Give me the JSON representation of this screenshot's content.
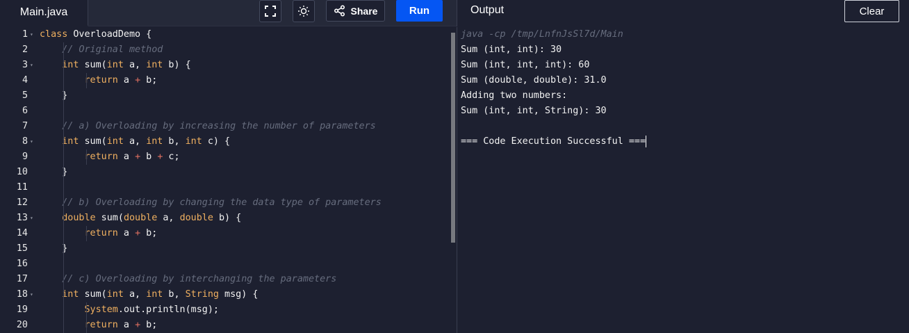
{
  "tab": {
    "label": "Main.java"
  },
  "toolbar": {
    "share_label": "Share",
    "run_label": "Run",
    "fullscreen_icon": "fullscreen-icon",
    "theme_icon": "sun-icon"
  },
  "output": {
    "title": "Output",
    "clear_label": "Clear",
    "command": "java -cp /tmp/LnfnJsSl7d/Main",
    "lines": [
      "Sum (int, int): 30",
      "Sum (int, int, int): 60",
      "Sum (double, double): 31.0",
      "Adding two numbers:",
      "Sum (int, int, String): 30",
      "",
      "=== Code Execution Successful ==="
    ]
  },
  "editor": {
    "lines": [
      {
        "n": "1",
        "fold": true,
        "parts": [
          [
            "kw",
            "class"
          ],
          [
            "t",
            " OverloadDemo {"
          ]
        ]
      },
      {
        "n": "2",
        "fold": false,
        "parts": [
          [
            "t",
            "    "
          ],
          [
            "cm",
            "// Original method"
          ]
        ]
      },
      {
        "n": "3",
        "fold": true,
        "parts": [
          [
            "t",
            "    "
          ],
          [
            "kw",
            "int"
          ],
          [
            "t",
            " sum("
          ],
          [
            "kw",
            "int"
          ],
          [
            "t",
            " a, "
          ],
          [
            "kw",
            "int"
          ],
          [
            "t",
            " b) {"
          ]
        ]
      },
      {
        "n": "4",
        "fold": false,
        "parts": [
          [
            "t",
            "        "
          ],
          [
            "kw",
            "return"
          ],
          [
            "t",
            " a "
          ],
          [
            "op",
            "+"
          ],
          [
            "t",
            " b;"
          ]
        ]
      },
      {
        "n": "5",
        "fold": false,
        "parts": [
          [
            "t",
            "    }"
          ]
        ]
      },
      {
        "n": "6",
        "fold": false,
        "parts": [
          [
            "t",
            ""
          ]
        ]
      },
      {
        "n": "7",
        "fold": false,
        "parts": [
          [
            "t",
            "    "
          ],
          [
            "cm",
            "// a) Overloading by increasing the number of parameters"
          ]
        ]
      },
      {
        "n": "8",
        "fold": true,
        "parts": [
          [
            "t",
            "    "
          ],
          [
            "kw",
            "int"
          ],
          [
            "t",
            " sum("
          ],
          [
            "kw",
            "int"
          ],
          [
            "t",
            " a, "
          ],
          [
            "kw",
            "int"
          ],
          [
            "t",
            " b, "
          ],
          [
            "kw",
            "int"
          ],
          [
            "t",
            " c) {"
          ]
        ]
      },
      {
        "n": "9",
        "fold": false,
        "parts": [
          [
            "t",
            "        "
          ],
          [
            "kw",
            "return"
          ],
          [
            "t",
            " a "
          ],
          [
            "op",
            "+"
          ],
          [
            "t",
            " b "
          ],
          [
            "op",
            "+"
          ],
          [
            "t",
            " c;"
          ]
        ]
      },
      {
        "n": "10",
        "fold": false,
        "parts": [
          [
            "t",
            "    }"
          ]
        ]
      },
      {
        "n": "11",
        "fold": false,
        "parts": [
          [
            "t",
            ""
          ]
        ]
      },
      {
        "n": "12",
        "fold": false,
        "parts": [
          [
            "t",
            "    "
          ],
          [
            "cm",
            "// b) Overloading by changing the data type of parameters"
          ]
        ]
      },
      {
        "n": "13",
        "fold": true,
        "parts": [
          [
            "t",
            "    "
          ],
          [
            "kw",
            "double"
          ],
          [
            "t",
            " sum("
          ],
          [
            "kw",
            "double"
          ],
          [
            "t",
            " a, "
          ],
          [
            "kw",
            "double"
          ],
          [
            "t",
            " b) {"
          ]
        ]
      },
      {
        "n": "14",
        "fold": false,
        "parts": [
          [
            "t",
            "        "
          ],
          [
            "kw",
            "return"
          ],
          [
            "t",
            " a "
          ],
          [
            "op",
            "+"
          ],
          [
            "t",
            " b;"
          ]
        ]
      },
      {
        "n": "15",
        "fold": false,
        "parts": [
          [
            "t",
            "    }"
          ]
        ]
      },
      {
        "n": "16",
        "fold": false,
        "parts": [
          [
            "t",
            ""
          ]
        ]
      },
      {
        "n": "17",
        "fold": false,
        "parts": [
          [
            "t",
            "    "
          ],
          [
            "cm",
            "// c) Overloading by interchanging the parameters"
          ]
        ]
      },
      {
        "n": "18",
        "fold": true,
        "parts": [
          [
            "t",
            "    "
          ],
          [
            "kw",
            "int"
          ],
          [
            "t",
            " sum("
          ],
          [
            "kw",
            "int"
          ],
          [
            "t",
            " a, "
          ],
          [
            "kw",
            "int"
          ],
          [
            "t",
            " b, "
          ],
          [
            "kw",
            "String"
          ],
          [
            "t",
            " msg) {"
          ]
        ]
      },
      {
        "n": "19",
        "fold": false,
        "parts": [
          [
            "t",
            "        "
          ],
          [
            "kw",
            "System"
          ],
          [
            "t",
            "."
          ],
          [
            "t",
            "out.println(msg);"
          ]
        ]
      },
      {
        "n": "20",
        "fold": false,
        "parts": [
          [
            "t",
            "        "
          ],
          [
            "kw",
            "return"
          ],
          [
            "t",
            " a "
          ],
          [
            "op",
            "+"
          ],
          [
            "t",
            " b;"
          ]
        ]
      }
    ]
  }
}
